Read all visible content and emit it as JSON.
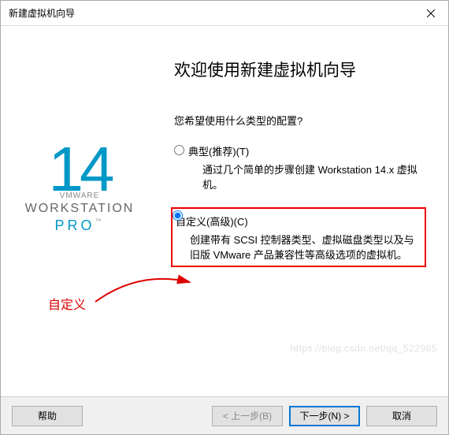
{
  "titlebar": {
    "title": "新建虚拟机向导"
  },
  "logo": {
    "number": "14",
    "vmware": "VMWARE",
    "workstation": "WORKSTATION",
    "pro": "PRO",
    "tm": "™"
  },
  "annotation": {
    "text": "自定义"
  },
  "main": {
    "heading": "欢迎使用新建虚拟机向导",
    "prompt": "您希望使用什么类型的配置?",
    "options": [
      {
        "label": "典型(推荐)(T)",
        "desc": "通过几个简单的步骤创建 Workstation 14.x 虚拟机。"
      },
      {
        "label": "自定义(高级)(C)",
        "desc": "创建带有 SCSI 控制器类型、虚拟磁盘类型以及与旧版 VMware 产品兼容性等高级选项的虚拟机。"
      }
    ]
  },
  "buttons": {
    "help": "帮助",
    "back": "< 上一步(B)",
    "next": "下一步(N) >",
    "cancel": "取消"
  },
  "watermark": "https://blog.csdn.net/qq_522985"
}
